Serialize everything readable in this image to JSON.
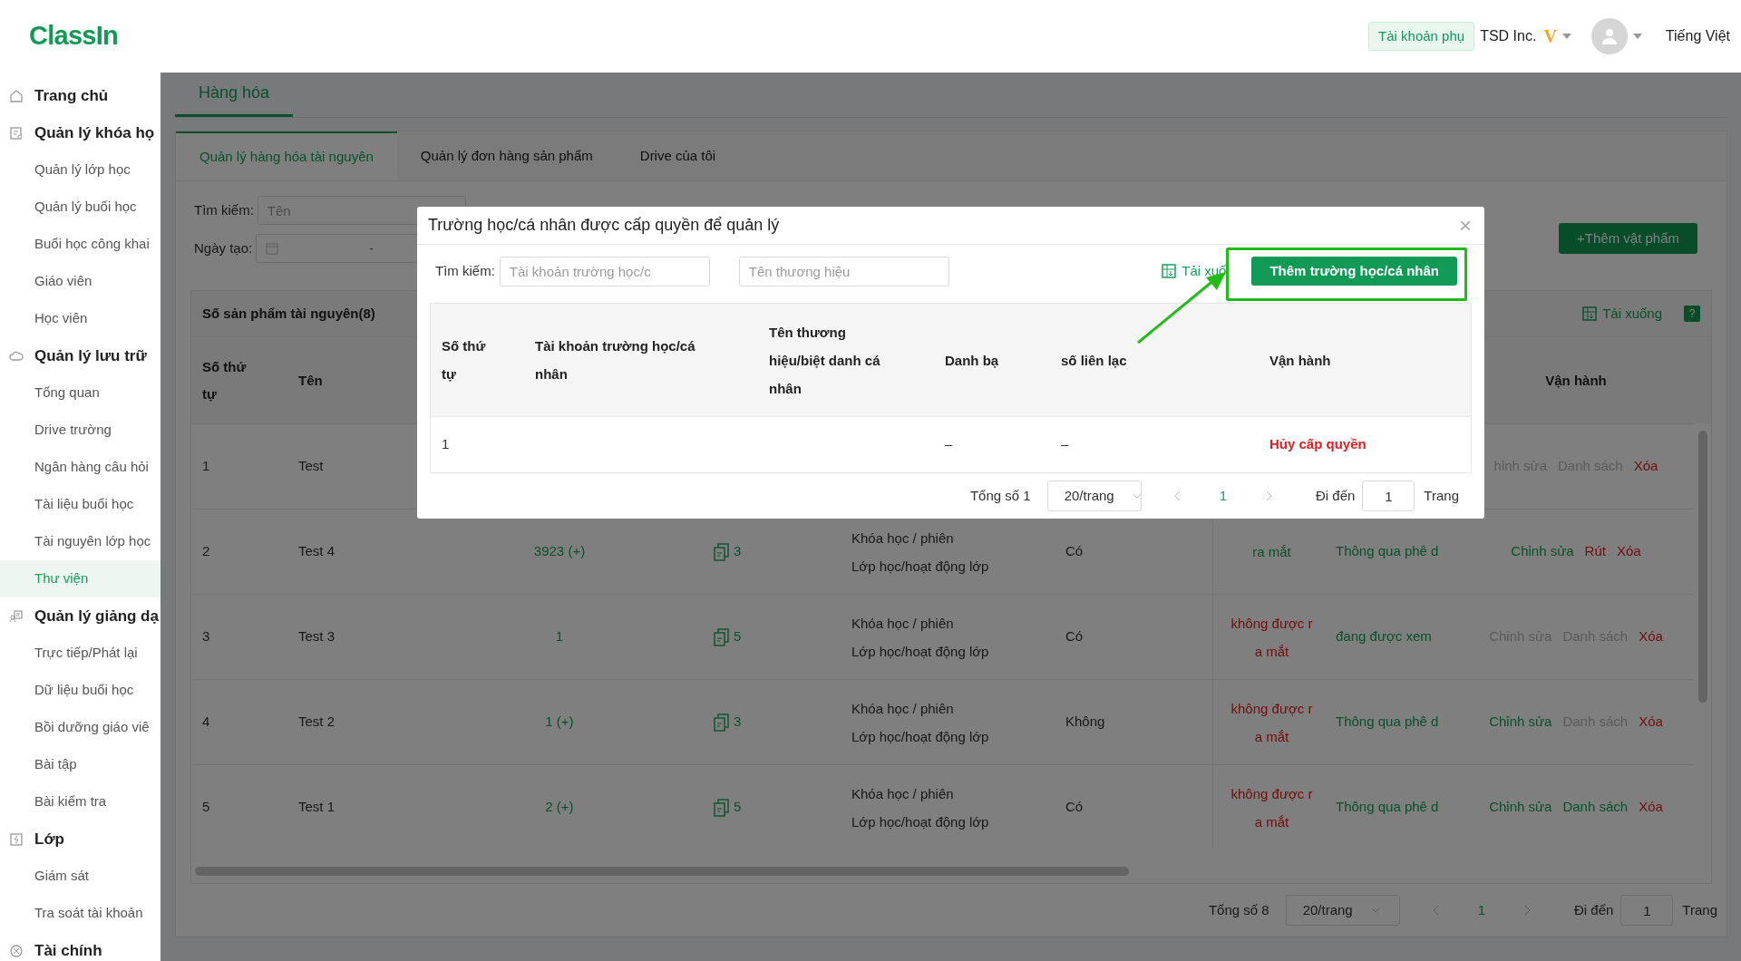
{
  "header": {
    "logo": "ClassIn",
    "account_badge": "Tài khoản phụ",
    "organization": "TSD Inc.",
    "vip": "V",
    "language": "Tiếng Việt"
  },
  "sidebar": [
    {
      "label": "Trang chủ"
    },
    {
      "label": "Quản lý khóa họ",
      "children": [
        {
          "label": "Quản lý lớp học",
          "selected": false
        },
        {
          "label": "Quản lý buổi học",
          "selected": false
        },
        {
          "label": "Buổi học công khai",
          "selected": false
        },
        {
          "label": "Giáo viên",
          "selected": false
        },
        {
          "label": "Học viên",
          "selected": false
        }
      ]
    },
    {
      "label": "Quản lý lưu trữ",
      "children": [
        {
          "label": "Tổng quan",
          "selected": false
        },
        {
          "label": "Drive trường",
          "selected": false
        },
        {
          "label": "Ngân hàng câu hỏi",
          "selected": false
        },
        {
          "label": "Tài liệu buổi học",
          "selected": false
        },
        {
          "label": "Tài nguyên lớp học",
          "selected": false
        },
        {
          "label": "Thư viện",
          "selected": true
        }
      ]
    },
    {
      "label": "Quản lý giảng dạ",
      "children": [
        {
          "label": "Trực tiếp/Phát lại",
          "selected": false
        },
        {
          "label": "Dữ liệu buổi học",
          "selected": false
        },
        {
          "label": "Bồi dưỡng giáo viê",
          "selected": false
        },
        {
          "label": "Bài tập",
          "selected": false
        },
        {
          "label": "Bài kiểm tra",
          "selected": false
        }
      ]
    },
    {
      "label": "Lớp",
      "children": [
        {
          "label": "Giám sát",
          "selected": false
        },
        {
          "label": "Tra soát tài khoản",
          "selected": false
        }
      ]
    },
    {
      "label": "Tài chính"
    }
  ],
  "page_tab": "Hàng hóa",
  "subtabs": [
    {
      "label": "Quản lý hàng hóa tài nguyên",
      "selected": true
    },
    {
      "label": "Quản lý đơn hàng sản phẩm",
      "selected": false
    },
    {
      "label": "Drive của tôi",
      "selected": false
    }
  ],
  "filters": {
    "search_label": "Tìm kiếm:",
    "search_placeholder": "Tên",
    "date_label": "Ngày tạo:",
    "date_separator": "-",
    "add_button": "+Thêm vật phẩm"
  },
  "table": {
    "title": "Số sản phẩm tài nguyên(8)",
    "download": "Tải xuống",
    "help": "?",
    "columns": [
      "Số thứ tự",
      "Tên",
      "Vận hành"
    ],
    "rows": [
      {
        "index": "1",
        "name": "Test",
        "actions": [
          {
            "label": "hỉnh sửa",
            "kind": "disabled"
          },
          {
            "label": "Danh sách",
            "kind": "disabled"
          },
          {
            "label": "Xóa",
            "kind": "danger"
          }
        ]
      },
      {
        "index": "2",
        "name": "Test 4",
        "count": "3923 (+)",
        "files": "3",
        "type_lines": [
          "Khóa học / phiên",
          "Lớp học/hoạt động lớp"
        ],
        "contact": "Có",
        "status": {
          "kind": "published",
          "lines": [
            "ra mắt"
          ]
        },
        "approval": "Thông qua phê d",
        "actions": [
          {
            "label": "Chỉnh sửa",
            "kind": "link"
          },
          {
            "label": "Rút",
            "kind": "danger"
          },
          {
            "label": "Xóa",
            "kind": "danger"
          }
        ]
      },
      {
        "index": "3",
        "name": "Test 3",
        "count": "1",
        "files": "5",
        "type_lines": [
          "Khóa học / phiên",
          "Lớp học/hoạt động lớp"
        ],
        "contact": "Có",
        "status": {
          "kind": "unpublished",
          "lines": [
            "không được r",
            "a mắt"
          ]
        },
        "approval": "đang được xem",
        "actions": [
          {
            "label": "Chỉnh sửa",
            "kind": "disabled"
          },
          {
            "label": "Danh sách",
            "kind": "disabled"
          },
          {
            "label": "Xóa",
            "kind": "danger"
          }
        ]
      },
      {
        "index": "4",
        "name": "Test 2",
        "count": "1 (+)",
        "files": "3",
        "type_lines": [
          "Khóa học / phiên",
          "Lớp học/hoạt động lớp"
        ],
        "contact": "Không",
        "status": {
          "kind": "unpublished",
          "lines": [
            "không được r",
            "a mắt"
          ]
        },
        "approval": "Thông qua phê d",
        "actions": [
          {
            "label": "Chỉnh sửa",
            "kind": "link"
          },
          {
            "label": "Danh sách",
            "kind": "disabled"
          },
          {
            "label": "Xóa",
            "kind": "danger"
          }
        ]
      },
      {
        "index": "5",
        "name": "Test 1",
        "count": "2 (+)",
        "files": "5",
        "type_lines": [
          "Khóa học / phiên",
          "Lớp học/hoạt động lớp"
        ],
        "contact": "Có",
        "status": {
          "kind": "unpublished",
          "lines": [
            "không được r",
            "a mắt"
          ]
        },
        "approval": "Thông qua phê d",
        "actions": [
          {
            "label": "Chỉnh sửa",
            "kind": "link"
          },
          {
            "label": "Danh sách",
            "kind": "link"
          },
          {
            "label": "Xóa",
            "kind": "danger"
          }
        ]
      }
    ]
  },
  "pagination": {
    "total": "Tổng số 8",
    "page_size": "20/trang",
    "page": "1",
    "goto_label": "Đi đến",
    "goto_value": "1",
    "page_suffix": "Trang"
  },
  "modal": {
    "title": "Trường học/cá nhân được cấp quyền để quản lý",
    "close": "×",
    "search_label": "Tìm kiếm:",
    "account_placeholder": "Tài khoản trường học/c",
    "brand_placeholder": "Tên thương hiệu",
    "download": "Tải xuố",
    "add_button": "Thêm trường học/cá nhân",
    "columns": [
      "Số thứ tự",
      "Tài khoản trường học/cá nhân",
      "Tên thương hiệu/biệt danh cá nhân",
      "Danh bạ",
      "số liên lạc",
      "Vận hành"
    ],
    "rows": [
      {
        "index": "1",
        "contacts": "–",
        "phone": "–",
        "action": "Hủy cấp quyền"
      }
    ],
    "pagination": {
      "total": "Tổng số 1",
      "page_size": "20/trang",
      "page": "1",
      "goto_label": "Đi đến",
      "goto_value": "1",
      "page_suffix": "Trang"
    }
  }
}
